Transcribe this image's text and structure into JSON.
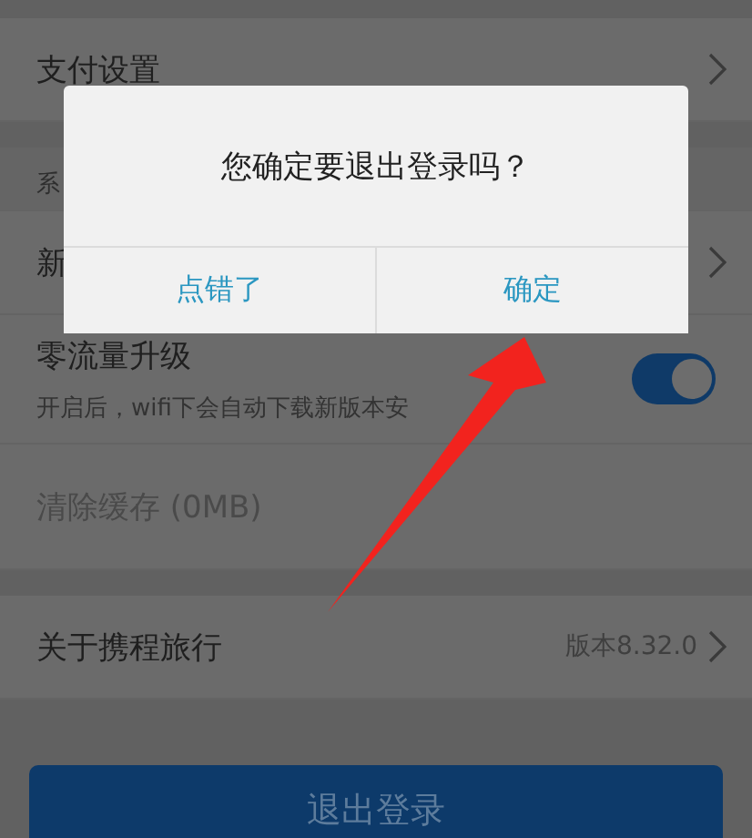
{
  "groups": [
    [
      {
        "kind": "link",
        "label": "支付设置"
      }
    ],
    [
      {
        "kind": "section",
        "label": "系"
      },
      {
        "kind": "link",
        "label": "新"
      },
      {
        "kind": "toggle",
        "label": "零流量升级",
        "subtitle": "开启后，wifi下会自动下载新版本安",
        "on": true
      },
      {
        "kind": "action",
        "label": "清除缓存 (0MB)",
        "disabled": true
      }
    ],
    [
      {
        "kind": "link",
        "label": "关于携程旅行",
        "value": "版本8.32.0"
      }
    ]
  ],
  "logout_button": "退出登录",
  "dialog": {
    "message": "您确定要退出登录吗？",
    "buttons": [
      "点错了",
      "确定"
    ]
  }
}
